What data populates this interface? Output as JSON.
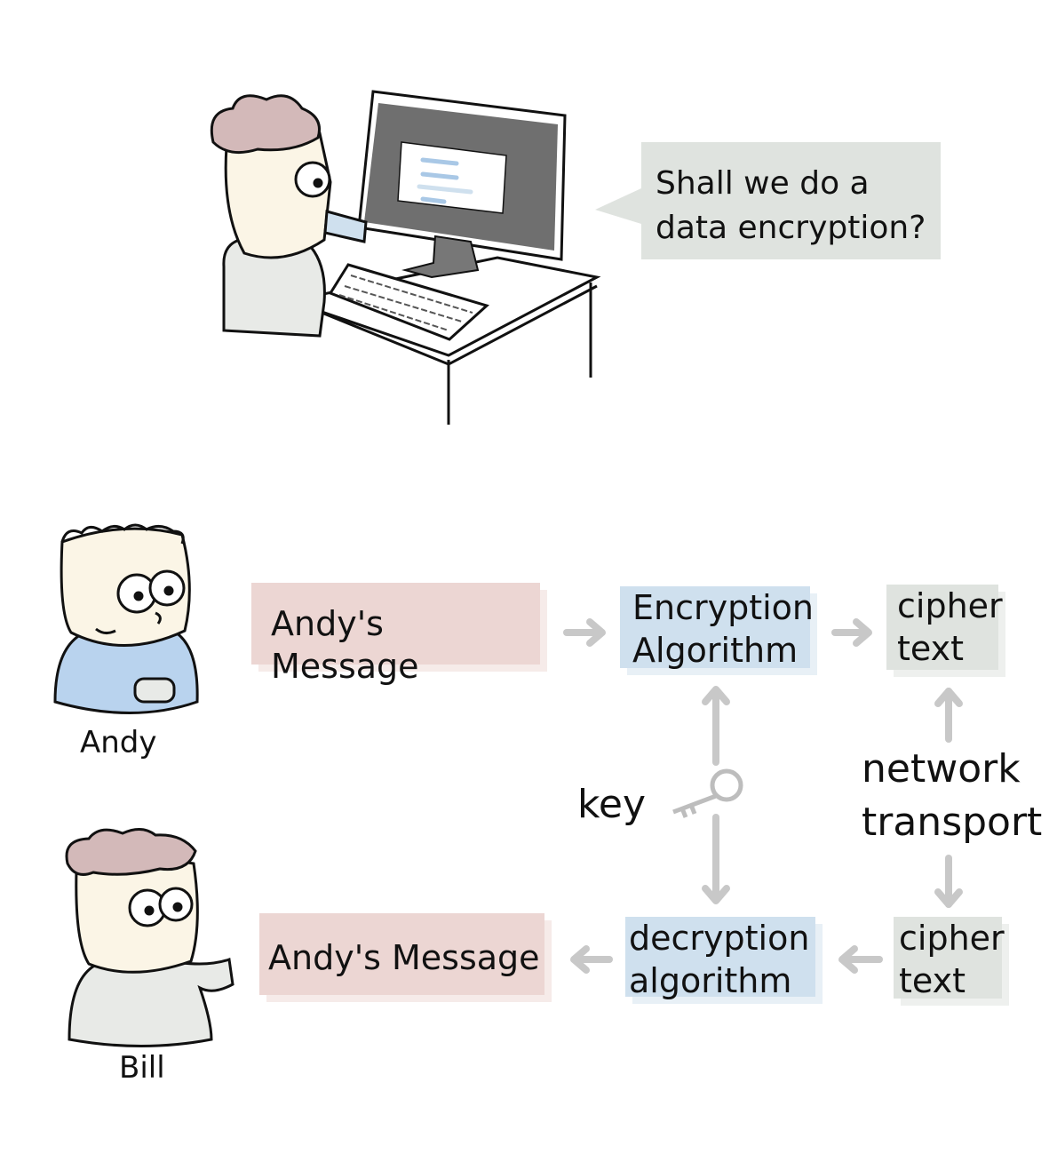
{
  "speech_bubble": {
    "line1": "Shall we do a",
    "line2": "data encryption?"
  },
  "people": {
    "sender": "Andy",
    "receiver": "Bill"
  },
  "flow": {
    "top": {
      "message": "Andy's Message",
      "algorithm_line1": "Encryption",
      "algorithm_line2": "Algorithm",
      "cipher_line1": "cipher",
      "cipher_line2": "text"
    },
    "bottom": {
      "message": "Andy's Message",
      "algorithm_line1": "decryption",
      "algorithm_line2": "algorithm",
      "cipher_line1": "cipher",
      "cipher_line2": "text"
    },
    "key_label": "key",
    "network_line1": "network",
    "network_line2": "transport"
  },
  "colors": {
    "message_box": "#ecd6d3",
    "algorithm_box": "#cfe0ee",
    "cipher_box": "#dfe3df",
    "arrow": "#c8c8c8"
  }
}
